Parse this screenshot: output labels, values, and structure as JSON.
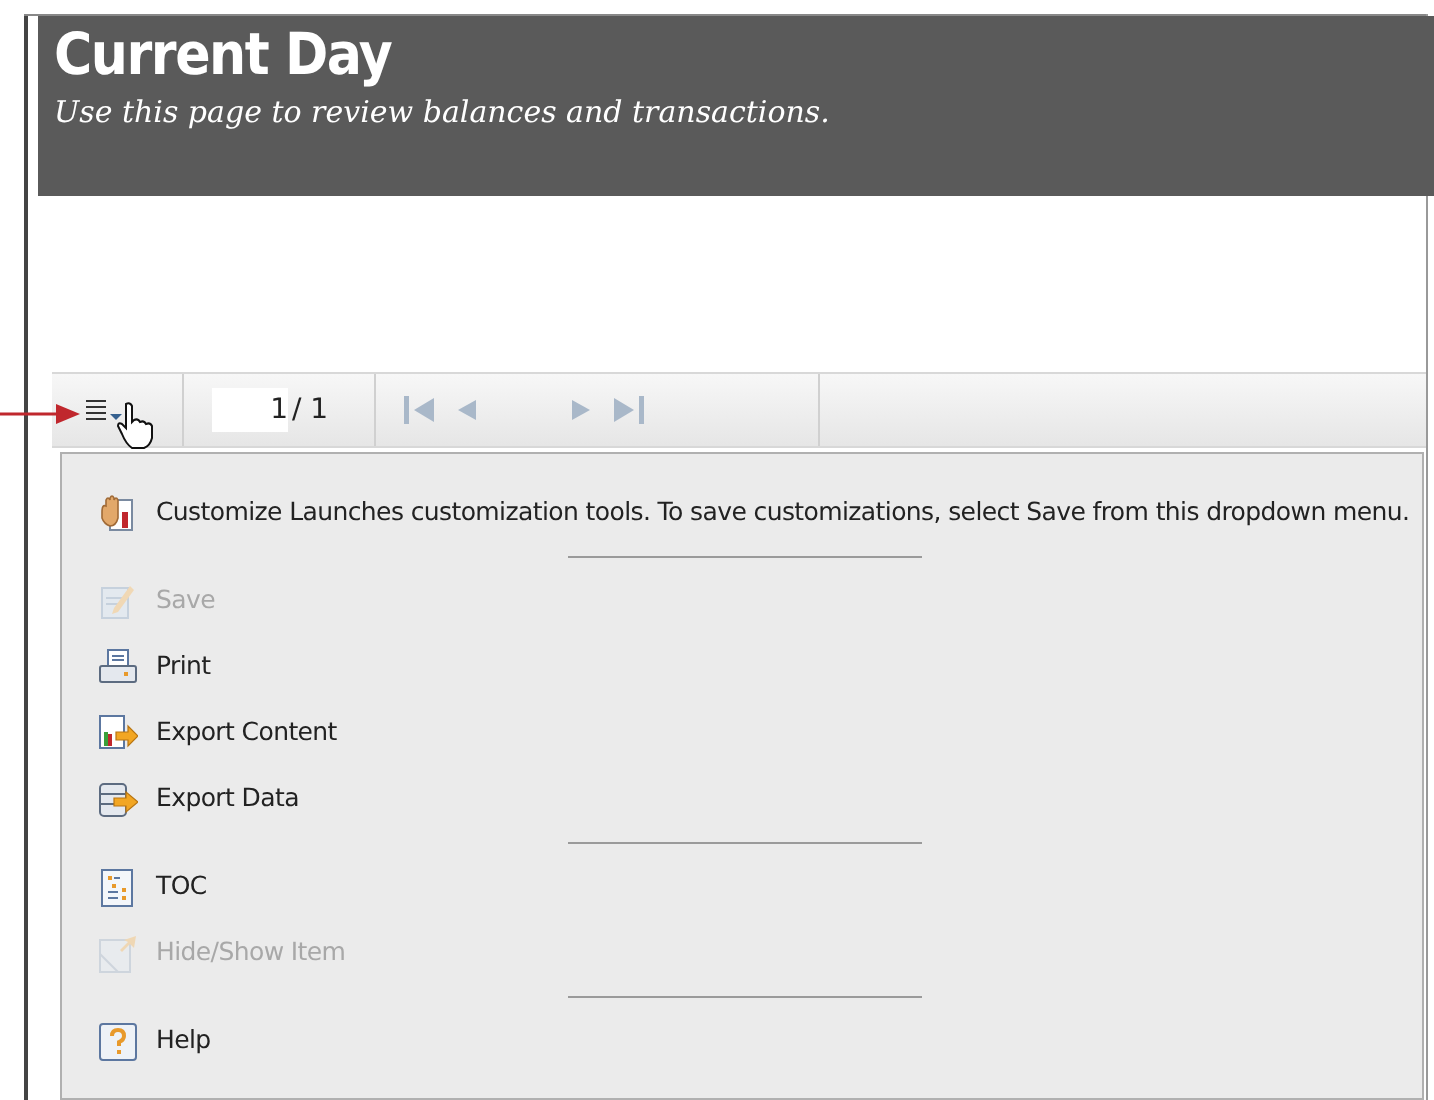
{
  "header": {
    "title": "Current Day",
    "subtitle": "Use this page to review balances and transactions."
  },
  "toolbar": {
    "page_value": "1",
    "page_total": "/ 1"
  },
  "menu": {
    "items": [
      {
        "kind": "customize",
        "label": "Customize Launches customization tools. To save customizations, select Save from this dropdown menu.",
        "disabled": false
      },
      {
        "kind": "separator"
      },
      {
        "kind": "save",
        "label": "Save",
        "disabled": true
      },
      {
        "kind": "print",
        "label": "Print",
        "disabled": false
      },
      {
        "kind": "export-content",
        "label": "Export Content",
        "disabled": false
      },
      {
        "kind": "export-data",
        "label": "Export Data",
        "disabled": false
      },
      {
        "kind": "separator"
      },
      {
        "kind": "toc",
        "label": "TOC",
        "disabled": false
      },
      {
        "kind": "hide-show",
        "label": "Hide/Show Item",
        "disabled": true
      },
      {
        "kind": "separator"
      },
      {
        "kind": "help",
        "label": "Help",
        "disabled": false
      }
    ]
  }
}
